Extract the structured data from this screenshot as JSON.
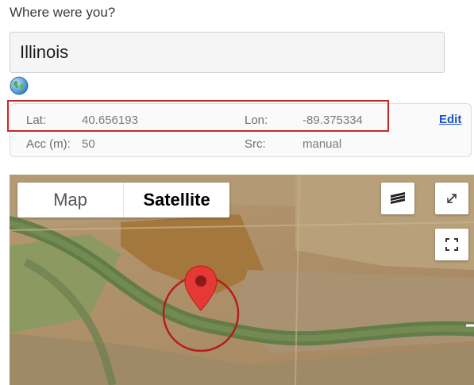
{
  "question": "Where were you?",
  "location_input": {
    "value": "Illinois"
  },
  "coords": {
    "lat_label": "Lat:",
    "lat_value": "40.656193",
    "lon_label": "Lon:",
    "lon_value": "-89.375334",
    "acc_label": "Acc (m):",
    "acc_value": "50",
    "src_label": "Src:",
    "src_value": "manual",
    "edit_label": "Edit"
  },
  "map": {
    "type_options": [
      "Map",
      "Satellite"
    ],
    "selected_type": "Satellite",
    "icons": [
      "layers-icon",
      "external-link-icon",
      "fullscreen-icon",
      "map-pin-icon"
    ],
    "pin_color": "#e53935",
    "circle_color": "#b71c1c"
  },
  "colors": {
    "edit_link": "#1a52c7",
    "highlight": "#c62828"
  }
}
